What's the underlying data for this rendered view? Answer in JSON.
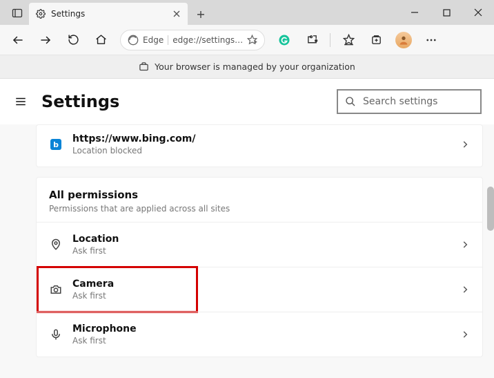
{
  "tab": {
    "title": "Settings"
  },
  "addressbar": {
    "edge_label": "Edge",
    "url": "edge://settings…"
  },
  "managed_banner": "Your browser is managed by your organization",
  "header": {
    "title": "Settings",
    "search_placeholder": "Search settings"
  },
  "recent": {
    "site": "https://www.bing.com/",
    "detail": "Location blocked"
  },
  "all_permissions": {
    "title": "All permissions",
    "subtitle": "Permissions that are applied across all sites",
    "items": [
      {
        "title": "Location",
        "subtitle": "Ask first",
        "icon": "location"
      },
      {
        "title": "Camera",
        "subtitle": "Ask first",
        "icon": "camera",
        "highlighted": true
      },
      {
        "title": "Microphone",
        "subtitle": "Ask first",
        "icon": "microphone"
      }
    ]
  }
}
